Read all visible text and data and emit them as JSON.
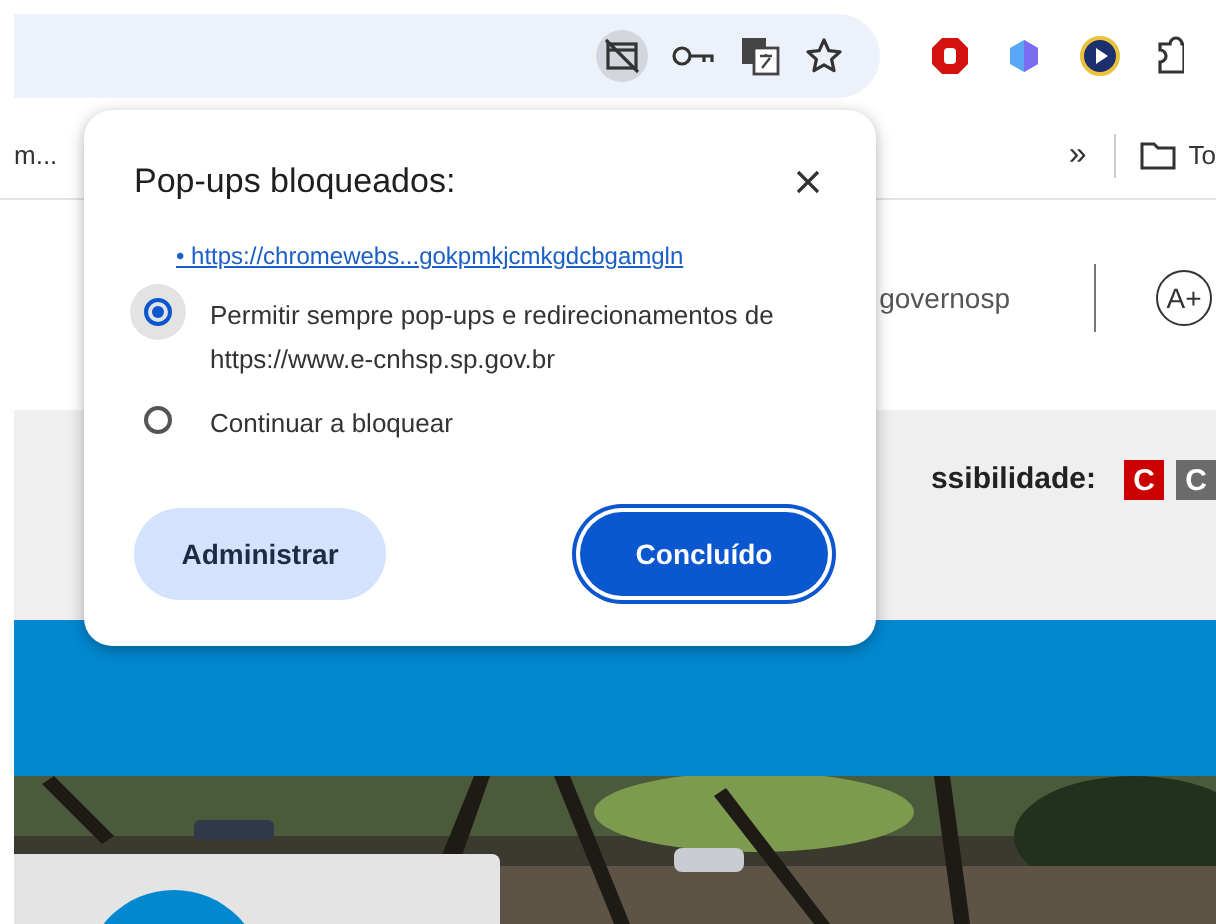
{
  "address_bar": {
    "popup_icon_highlighted": true
  },
  "bookmarks_bar": {
    "items": [
      {
        "label": "m..."
      },
      {
        "label": "To"
      }
    ],
    "overflow": "»"
  },
  "page": {
    "header_link": "governosp",
    "font_button": "A+",
    "accessibility_label": "ssibilidade:",
    "contrast_buttons": [
      {
        "label": "C",
        "color": "#cc0000"
      },
      {
        "label": "C",
        "color": "#6b6b6b"
      }
    ]
  },
  "popup": {
    "title": "Pop-ups bloqueados:",
    "link": "• https://chromewebs...gokpmkjcmkgdcbgamgln",
    "options": [
      {
        "label": "Permitir sempre pop-ups e redirecionamentos de https://www.e-cnhsp.sp.gov.br",
        "selected": true
      },
      {
        "label": "Continuar a bloquear",
        "selected": false
      }
    ],
    "buttons": [
      {
        "label": "Administrar",
        "kind": "secondary"
      },
      {
        "label": "Concluído",
        "kind": "primary"
      }
    ]
  }
}
